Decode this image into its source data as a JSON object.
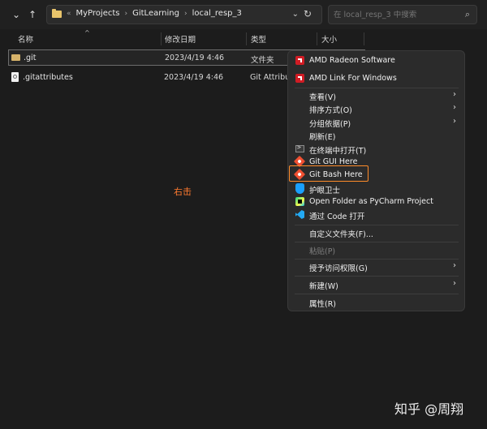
{
  "top": {
    "breadcrumbs": [
      "MyProjects",
      "GitLearning",
      "local_resp_3"
    ],
    "search_placeholder": "在 local_resp_3 中搜索"
  },
  "columns": {
    "name": "名称",
    "modified": "修改日期",
    "type": "类型",
    "size": "大小"
  },
  "files": [
    {
      "name": ".git",
      "date": "2023/4/19 4:46",
      "type": "文件夹",
      "selected": true
    },
    {
      "name": ".gitattributes",
      "date": "2023/4/19 4:46",
      "type": "Git Attribu"
    }
  ],
  "annotation": {
    "text": "右击",
    "color": "#ff7a2f"
  },
  "context_menu": {
    "items": [
      {
        "label": "AMD Radeon Software",
        "icon": "amd-icon"
      },
      {
        "label": "AMD Link For Windows",
        "icon": "amd-icon"
      },
      {
        "label": "查看(V)",
        "submenu": true
      },
      {
        "label": "排序方式(O)",
        "submenu": true
      },
      {
        "label": "分组依据(P)",
        "submenu": true
      },
      {
        "label": "刷新(E)"
      },
      {
        "label": "在终端中打开(T)",
        "icon": "terminal-icon"
      },
      {
        "label": "Git GUI Here",
        "icon": "git-icon"
      },
      {
        "label": "Git Bash Here",
        "icon": "git-icon",
        "highlighted": true
      },
      {
        "label": "护眼卫士",
        "icon": "shield-icon"
      },
      {
        "label": "Open Folder as PyCharm Project",
        "icon": "pycharm-icon"
      },
      {
        "label": "通过 Code 打开",
        "icon": "vscode-icon"
      },
      {
        "label": "自定义文件夹(F)..."
      },
      {
        "label": "粘贴(P)",
        "disabled": true
      },
      {
        "label": "授予访问权限(G)",
        "submenu": true
      },
      {
        "label": "新建(W)",
        "submenu": true
      },
      {
        "label": "属性(R)"
      }
    ]
  },
  "watermark": {
    "text": "知乎 @周翔"
  },
  "colors": {
    "accent_highlight": "#ff8c2a",
    "annotation": "#ff7a2f",
    "amd": "#d11c24",
    "git": "#f05032"
  }
}
